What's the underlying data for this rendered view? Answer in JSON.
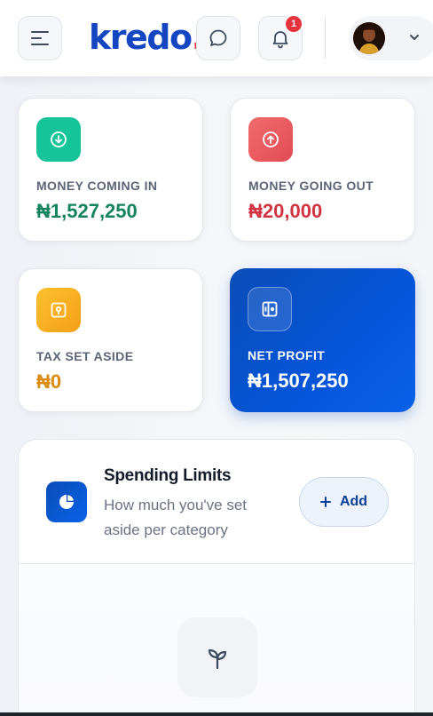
{
  "header": {
    "logo_text": "kredo",
    "logo_dot": ".",
    "notification_count": "1"
  },
  "stats": [
    {
      "label": "MONEY COMING IN",
      "value": "₦1,527,250",
      "icon": "arrow-down-circle-icon",
      "color": "#16c49a"
    },
    {
      "label": "MONEY GOING OUT",
      "value": "₦20,000",
      "icon": "arrow-up-circle-icon",
      "color": "#e34b55"
    },
    {
      "label": "TAX SET ASIDE",
      "value": "₦0",
      "icon": "safe-icon",
      "color": "#f5a017"
    },
    {
      "label": "NET PROFIT",
      "value": "₦1,507,250",
      "icon": "vault-icon",
      "color": "#0555d9"
    }
  ],
  "spending_limits": {
    "title": "Spending Limits",
    "subtitle": "How much you've set aside per category",
    "add_label": "Add",
    "add_icon": "plus-icon",
    "empty_icon": "sprout-icon"
  }
}
